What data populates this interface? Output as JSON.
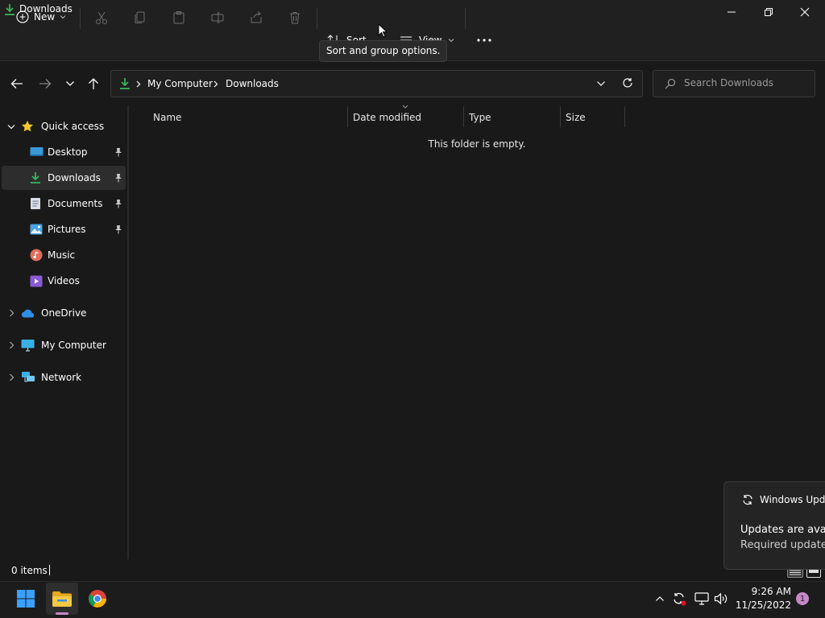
{
  "window": {
    "title": "Downloads"
  },
  "toolbar": {
    "new_label": "New",
    "sort_label": "Sort",
    "view_label": "View",
    "tooltip": "Sort and group options."
  },
  "address": {
    "segments": [
      "My Computer",
      "Downloads"
    ]
  },
  "search": {
    "placeholder": "Search Downloads"
  },
  "sidebar": {
    "quick_access": "Quick access",
    "items": [
      {
        "label": "Desktop",
        "pinned": true
      },
      {
        "label": "Downloads",
        "pinned": true,
        "selected": true
      },
      {
        "label": "Documents",
        "pinned": true
      },
      {
        "label": "Pictures",
        "pinned": true
      },
      {
        "label": "Music",
        "pinned": false
      },
      {
        "label": "Videos",
        "pinned": false
      }
    ],
    "onedrive": "OneDrive",
    "my_computer": "My Computer",
    "network": "Network"
  },
  "columns": [
    "Name",
    "Date modified",
    "Type",
    "Size"
  ],
  "content": {
    "empty_message": "This folder is empty."
  },
  "status": {
    "item_count": "0 items"
  },
  "notification": {
    "title": "Windows Upda",
    "line1": "Updates are avail",
    "line2": "Required updates"
  },
  "taskbar": {
    "time": "9:26 AM",
    "date": "11/25/2022",
    "notification_badge": "1"
  },
  "colors": {
    "accent_green": "#3db35a",
    "star": "#f7c52b",
    "taskbar_active": "#c589c7"
  }
}
